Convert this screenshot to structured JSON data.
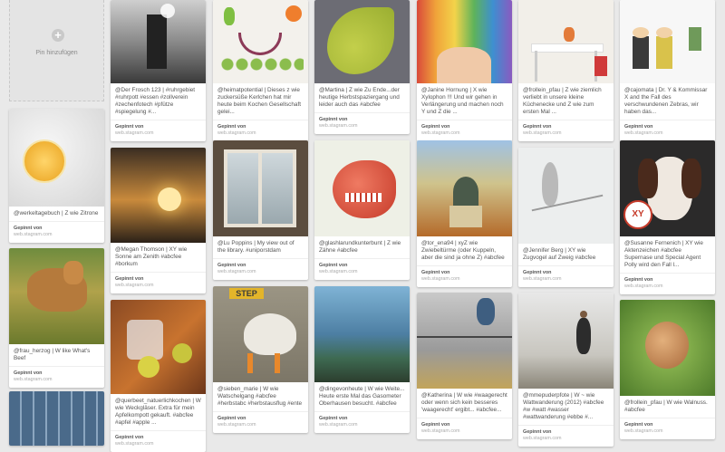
{
  "add_pin": {
    "label": "Pin hinzufügen"
  },
  "pins": [
    {
      "desc": "@werkeltagebuch | Z wie Zitrone",
      "src_label": "Gepinnt von",
      "src_site": "web.stagram.com"
    },
    {
      "desc": "@frau_herzog | W like What's Beef",
      "src_label": "Gepinnt von",
      "src_site": "web.stagram.com"
    },
    {
      "desc": "@Der Frosch 123 | #ruhrgebiet #ruhrpott #essen #zollverein #zechenfotech #pfütze #spiegelung #...",
      "src_label": "Gepinnt von",
      "src_site": "web.stagram.com"
    },
    {
      "desc": "@Megan Thomson | XY wie Sonne am Zenith #abcfee #borkum",
      "src_label": "Gepinnt von",
      "src_site": "web.stagram.com"
    },
    {
      "desc": "@querbeet_natuerlichkochen | W wie Weckgläser. Extra für mein Apfelkompott gekauft. #abcfee #apfel #apple ...",
      "src_label": "Gepinnt von",
      "src_site": "web.stagram.com"
    },
    {
      "desc": "@heimatpotential | Dieses z wie zuckersüße Kerlchen hat mir heute beim Kochen Gesellschaft gelei...",
      "src_label": "Gepinnt von",
      "src_site": "web.stagram.com"
    },
    {
      "desc": "@Lu Poppins | My view out of the library. #uniporstdam",
      "src_label": "Gepinnt von",
      "src_site": "web.stagram.com"
    },
    {
      "desc": "@sieben_marie | W wie Watschelgang #abcfee #herbstabc #herbstausflug #ente",
      "src_label": "Gepinnt von",
      "src_site": "web.stagram.com"
    },
    {
      "desc": "@Martina | Z wie Zu Ende...der heutige Herbstspaziergang und leider auch das #abcfee",
      "src_label": "Gepinnt von",
      "src_site": "web.stagram.com"
    },
    {
      "desc": "@glashlarundkunterbunt | Z wie Zähne #abcfee",
      "src_label": "Gepinnt von",
      "src_site": "web.stagram.com"
    },
    {
      "desc": "@dingevonheute | W wie Weite... Heute erste Mal das Gasometer Oberhausen besucht. #abcfee",
      "src_label": "Gepinnt von",
      "src_site": "web.stagram.com"
    },
    {
      "desc": "@Janine Hornung | X wie Xylophon !!! Und wir gehen in Verlängerung und machen noch Y und Z die ...",
      "src_label": "Gepinnt von",
      "src_site": "web.stagram.com"
    },
    {
      "desc": "@tor_ena94 | xyZ wie Zwiebeltürme (oder Kuppeln, aber die sind ja ohne Z) #abcfee",
      "src_label": "Gepinnt von",
      "src_site": "web.stagram.com"
    },
    {
      "desc": "@Katherina | W wie #waagerecht oder wenn sich kein besseres 'waagerecht' ergibt... #abcfee...",
      "src_label": "Gepinnt von",
      "src_site": "web.stagram.com"
    },
    {
      "desc": "@frollein_pfau | Z wie ziemlich verliebt in unsere kleine Küchenecke und Z wie zum ersten Mal ...",
      "src_label": "Gepinnt von",
      "src_site": "web.stagram.com"
    },
    {
      "desc": "@Jennifer Berg | XY wie Zugvogel auf Zweig #abcfee",
      "src_label": "Gepinnt von",
      "src_site": "web.stagram.com"
    },
    {
      "desc": "@mmepuderpfote | W ~ wie Wattwanderung (2012) #abcfee #w #watt #wasser #wattwanderung #ebbe #...",
      "src_label": "Gepinnt von",
      "src_site": "web.stagram.com"
    },
    {
      "desc": "@cajomata | Dr. Y & Kommissar X and the Fall des verschwundenen Zebras, wir haben das...",
      "src_label": "Gepinnt von",
      "src_site": "web.stagram.com"
    },
    {
      "desc": "@Susanne Fernenich | XY wie Aktenzeichen #abcfee Supernase und Special Agent Polly wird den Fall l...",
      "src_label": "Gepinnt von",
      "src_site": "web.stagram.com"
    },
    {
      "desc": "@frollein_pfau | W wie Walnuss. #abcfee",
      "src_label": "Gepinnt von",
      "src_site": "web.stagram.com"
    },
    {
      "desc": "",
      "src_label": "",
      "src_site": ""
    }
  ]
}
